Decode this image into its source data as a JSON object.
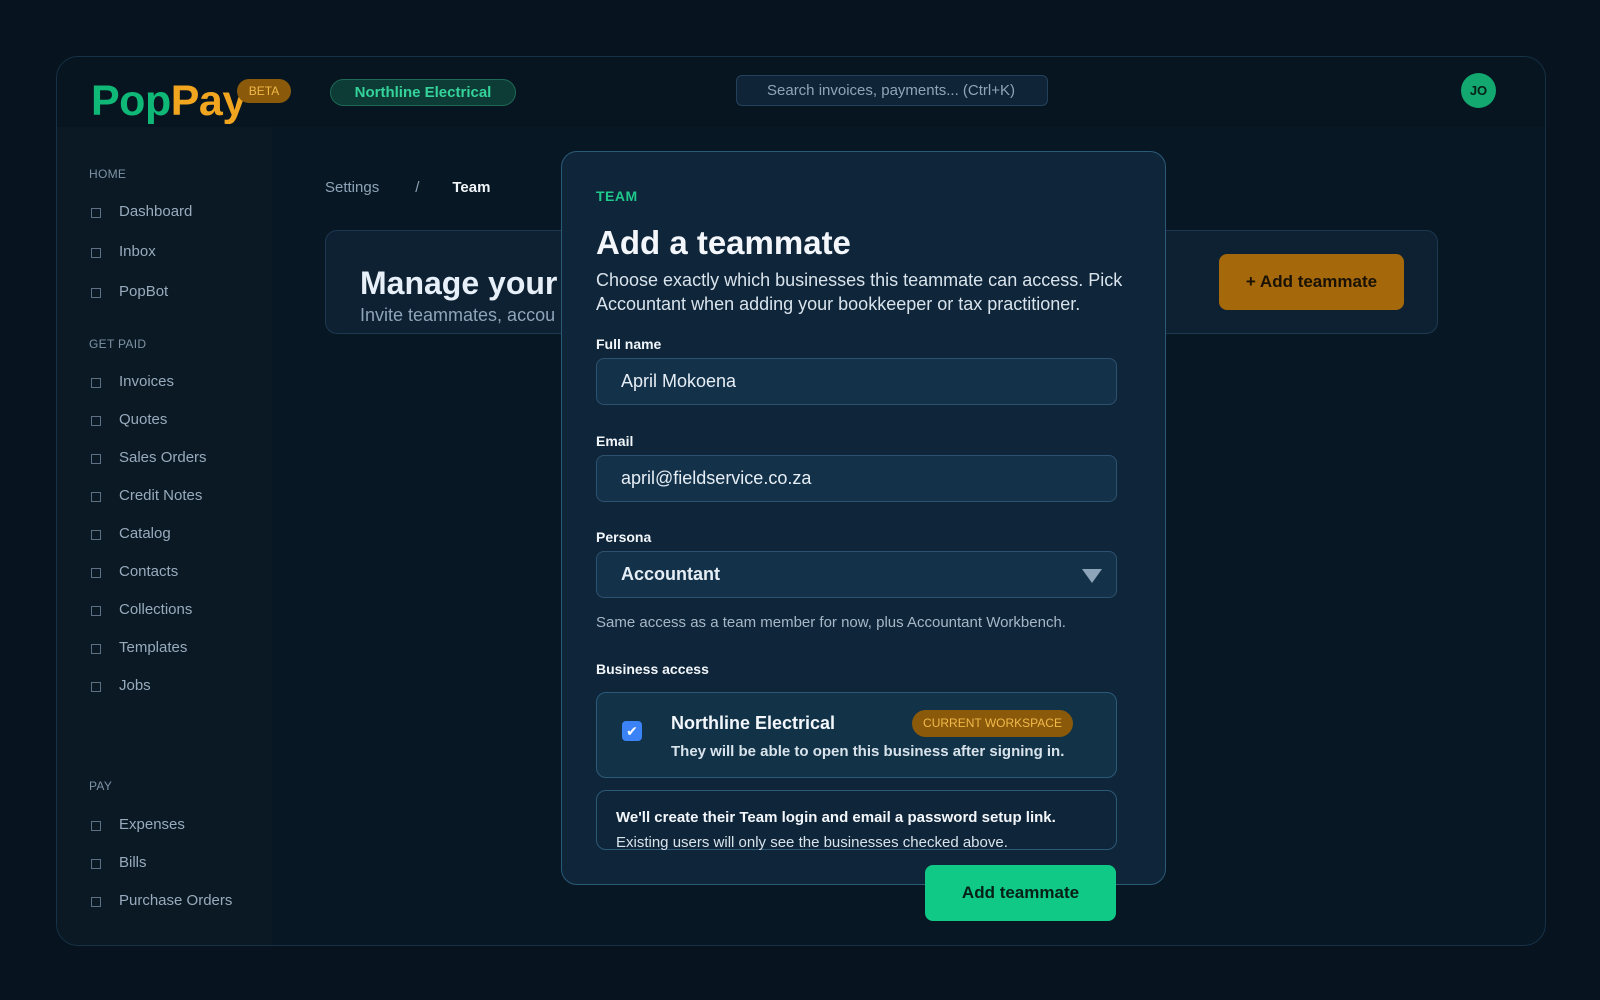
{
  "brand": {
    "pop": "Pop",
    "pay": "Pay",
    "badge": "BETA"
  },
  "topbar": {
    "business": "Northline Electrical",
    "search_placeholder": "Search invoices, payments... (Ctrl+K)",
    "avatar_initials": "JO"
  },
  "sidebar": {
    "sections": [
      {
        "title": "HOME",
        "items": [
          "Dashboard",
          "Inbox",
          "PopBot"
        ]
      },
      {
        "title": "GET PAID",
        "items": [
          "Invoices",
          "Quotes",
          "Sales Orders",
          "Credit Notes",
          "Catalog",
          "Contacts",
          "Collections",
          "Templates",
          "Jobs"
        ]
      },
      {
        "title": "PAY",
        "items": [
          "Expenses",
          "Bills",
          "Purchase Orders"
        ]
      }
    ]
  },
  "breadcrumb": {
    "parent": "Settings",
    "separator": "/",
    "current": "Team"
  },
  "header": {
    "title": "Manage your",
    "subtitle": "Invite teammates, accou",
    "add_button": "+  Add teammate"
  },
  "modal": {
    "eyebrow": "TEAM",
    "title": "Add a teammate",
    "description": "Choose exactly which businesses this teammate can access. Pick Accountant when adding your bookkeeper or tax practitioner.",
    "full_name_label": "Full name",
    "full_name_value": "April Mokoena",
    "email_label": "Email",
    "email_value": "april@fieldservice.co.za",
    "persona_label": "Persona",
    "persona_value": "Accountant",
    "persona_hint": "Same access as a team member for now, plus Accountant Workbench.",
    "access_label": "Business access",
    "access_business": "Northline Electrical",
    "access_badge": "CURRENT WORKSPACE",
    "access_description": "They will be able to open this business after signing in.",
    "access_checked": true,
    "info_title": "We'll create their Team login and email a password setup link.",
    "info_body": "Existing users will only see the businesses checked above.",
    "submit_label": "Add teammate"
  }
}
